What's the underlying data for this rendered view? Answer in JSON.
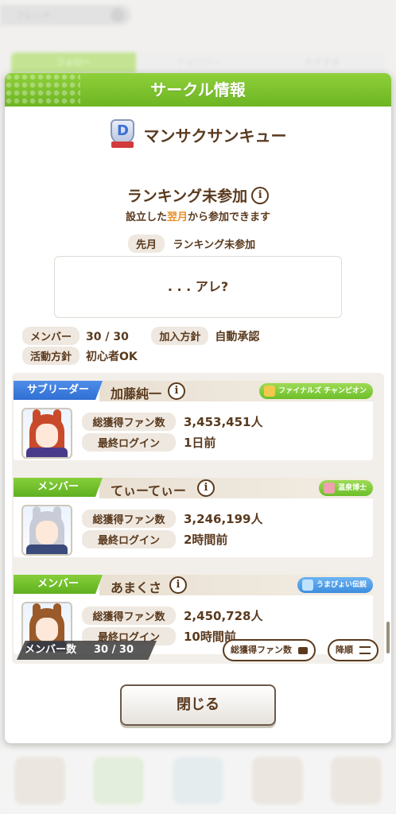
{
  "background": {
    "search_text": "フレンド",
    "tabs": [
      "フォロー",
      "フォロワー",
      "おすすめ"
    ]
  },
  "dialog": {
    "title": "サークル情報",
    "circle_rank": "D",
    "circle_name": "マンサクサンキュー",
    "ranking_status": "ランキング未参加",
    "ranking_sub_pre": "設立した",
    "ranking_sub_hl": "翌月",
    "ranking_sub_post": "から参加できます",
    "last_month_label": "先月",
    "last_month_value": "ランキング未参加",
    "comment": ". . . アレ?",
    "members_label": "メンバー",
    "members_value": "30 / 30",
    "join_policy_label": "加入方針",
    "join_policy_value": "自動承認",
    "activity_label": "活動方針",
    "activity_value": "初心者OK",
    "stat_fans_label": "総獲得ファン数",
    "stat_login_label": "最終ログイン",
    "members": [
      {
        "role": "サブリーダー",
        "name": "加藤純一",
        "title": "ファイナルズ チャンピオン",
        "fans": "3,453,451人",
        "last_login": "1日前"
      },
      {
        "role": "メンバー",
        "name": "てぃーてぃー",
        "title": "温泉博士",
        "fans": "3,246,199人",
        "last_login": "2時間前"
      },
      {
        "role": "メンバー",
        "name": "あまくさ",
        "title": "うまぴょい伝説",
        "fans": "2,450,728人",
        "last_login": "10時間前"
      }
    ],
    "member_count_label": "メンバー数",
    "member_count_value": "30 / 30",
    "sort_by_label": "総獲得ファン数",
    "sort_order_label": "降順",
    "close_label": "閉じる"
  }
}
